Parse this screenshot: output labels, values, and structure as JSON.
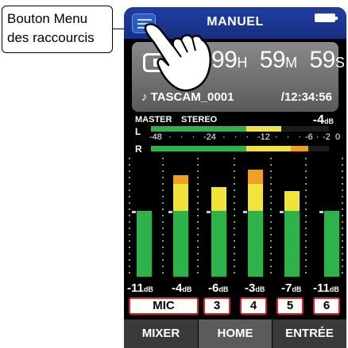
{
  "callout": {
    "line1": "Bouton Menu",
    "line2": "des raccourcis"
  },
  "header": {
    "title": "MANUEL",
    "menu_icon": "hamburger-menu-icon",
    "battery_icon": "battery-icon"
  },
  "time": {
    "hours": "99",
    "hours_unit": "H",
    "minutes": "59",
    "minutes_unit": "M",
    "seconds": "59",
    "seconds_unit": "S",
    "file_name": "♪ TASCAM_0001",
    "total": "/12:34:56"
  },
  "master": {
    "label": "MASTER",
    "mode": "STEREO",
    "level": "-4",
    "level_unit": "dB",
    "left_label": "L",
    "right_label": "R",
    "left_level_fraction": 0.73,
    "right_level_fraction": 0.81,
    "scale": [
      "-48",
      "-24",
      "-12",
      "-6",
      "-2",
      "0"
    ]
  },
  "channels": [
    {
      "level": "-11",
      "unit": "dB",
      "button": "MIC",
      "fill": 0.55
    },
    {
      "level": "-4",
      "unit": "dB",
      "button": "",
      "fill": 0.85
    },
    {
      "level": "-6",
      "unit": "dB",
      "button": "3",
      "fill": 0.75
    },
    {
      "level": "-3",
      "unit": "dB",
      "button": "4",
      "fill": 0.9
    },
    {
      "level": "-7",
      "unit": "dB",
      "button": "5",
      "fill": 0.72
    },
    {
      "level": "-11",
      "unit": "dB",
      "button": "6",
      "fill": 0.55
    }
  ],
  "tabs": {
    "mixer": "MIXER",
    "home": "HOME",
    "input": "ENTRÉE",
    "active": "HOME"
  },
  "colors": {
    "header": "#1f3da3",
    "green": "#2db34a",
    "yellow": "#f2e33a",
    "orange": "#f0a020",
    "channel_border": "#e02020"
  }
}
